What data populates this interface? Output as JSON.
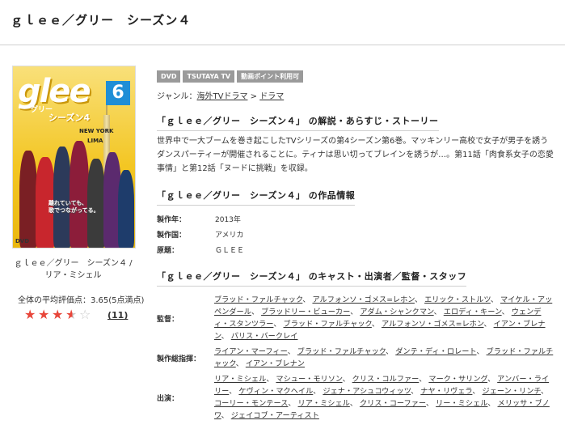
{
  "page": {
    "title": "ｇｌｅｅ／グリー　シーズン４"
  },
  "jacket": {
    "logo": "glee",
    "logo_sub": "グリー",
    "season": "シーズン4",
    "volume": "6",
    "city1": "NEW YORK",
    "city2": "LIMA",
    "caption_line1": "離れていても、",
    "caption_line2": "歌でつながってる。",
    "format": "DVD",
    "title_line1": "ｇｌｅｅ／グリー　シーズン４ /",
    "title_line2": "リア・ミシェル"
  },
  "rating": {
    "label": "全体の平均評価点：3.65(5点満点)",
    "value": 3.65,
    "max": 5,
    "review_count": "(11)",
    "colors": {
      "filled": "#e8463a",
      "empty": "#c9c9c9"
    }
  },
  "badges": [
    "DVD",
    "TSUTAYA TV",
    "動画ポイント利用可"
  ],
  "genre": {
    "label": "ジャンル：",
    "path": [
      "海外TVドラマ",
      "ドラマ"
    ],
    "separator": ">"
  },
  "synopsis": {
    "heading": "「ｇｌｅｅ／グリー　シーズン４」 の解説・あらすじ・ストーリー",
    "text": "世界中で一大ブームを巻き起こしたTVシリーズの第4シーズン第6巻。マッキンリー高校で女子が男子を誘うダンスパーティーが開催されることに。ティナは思い切ってブレインを誘うが…。第11話「肉食系女子の恋愛事情」と第12話「ヌードに挑戦」を収録。"
  },
  "info": {
    "heading": "「ｇｌｅｅ／グリー　シーズン４」 の作品情報",
    "rows": [
      {
        "label": "製作年：",
        "value": "2013年"
      },
      {
        "label": "製作国：",
        "value": "アメリカ"
      },
      {
        "label": "原題：",
        "value": "ＧＬＥＥ"
      }
    ]
  },
  "staff": {
    "heading": "「ｇｌｅｅ／グリー　シーズン４」 のキャスト・出演者／監督・スタッフ",
    "groups": [
      {
        "label": "監督：",
        "names": [
          "ブラッド・ファルチャック",
          "アルフォンソ・ゴメス=レホン",
          "エリック・ストルツ",
          "マイケル・アッペンダール",
          "ブラッドリー・ビューカー",
          "アダム・シャンクマン",
          "エロディ・キーン",
          "ウェンディ・スタンツラー",
          "ブラッド・ファルチャック",
          "アルフォンソ・ゴメス=レホン",
          "イアン・ブレナン",
          "パリス・バークレイ"
        ]
      },
      {
        "label": "製作総指揮：",
        "names": [
          "ライアン・マーフィー",
          "ブラッド・ファルチャック",
          "ダンテ・ディ・ロレート",
          "ブラッド・ファルチャック",
          "イアン・ブレナン"
        ]
      },
      {
        "label": "出演：",
        "names": [
          "リア・ミシェル",
          "マシュー・モリソン",
          "クリス・コルファー",
          "マーク・サリング",
          "アンバー・ライリー",
          "ケヴィン・マクヘイル",
          "ジェナ・アシュコウィッツ",
          "ナヤ・リヴェラ",
          "ジェーン・リンチ",
          "コーリー・モンテース",
          "リア・ミシェル",
          "クリス・コーファー",
          "リー・ミシェル",
          "メリッサ・ブノワ",
          "ジェイコブ・アーティスト"
        ]
      }
    ]
  }
}
